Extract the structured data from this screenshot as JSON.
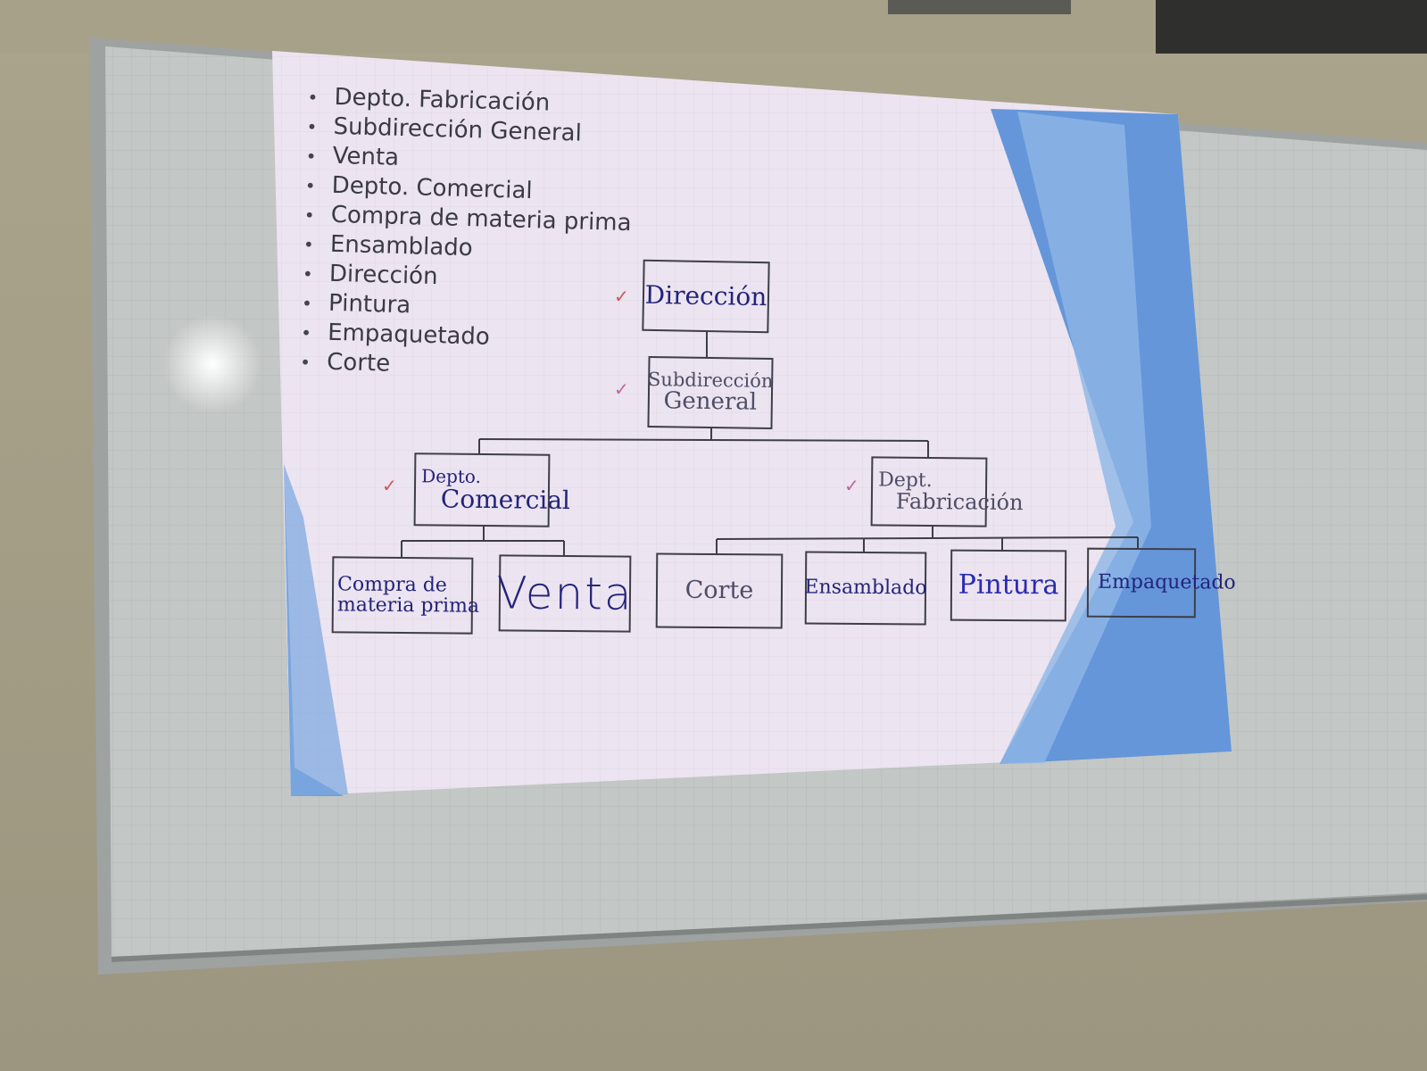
{
  "slide": {
    "bullets": [
      "Depto. Fabricación",
      "Subdirección General",
      "Venta",
      "Depto. Comercial",
      "Compra de materia prima",
      "Ensamblado",
      "Dirección",
      "Pintura",
      "Empaquetado",
      "Corte"
    ]
  },
  "org_chart": {
    "top": "Dirección",
    "second": [
      "Subdirección",
      "General"
    ],
    "left_dept": [
      "Depto.",
      "Comercial"
    ],
    "right_dept": [
      "Dept.",
      "Fabricación"
    ],
    "left_children": [
      [
        "Compra de",
        "materia prima"
      ],
      [
        "Venta"
      ]
    ],
    "right_children": [
      "Corte",
      "Ensamblado",
      "Pintura",
      "Empaquetado"
    ]
  },
  "colors": {
    "slide_bg": "#ece4f0",
    "accent_blue": "#5b8fd6",
    "ink_blue": "#23237a",
    "board_gray": "#c2c6c4"
  },
  "icons": {
    "bullet": "•",
    "check": "✓"
  }
}
